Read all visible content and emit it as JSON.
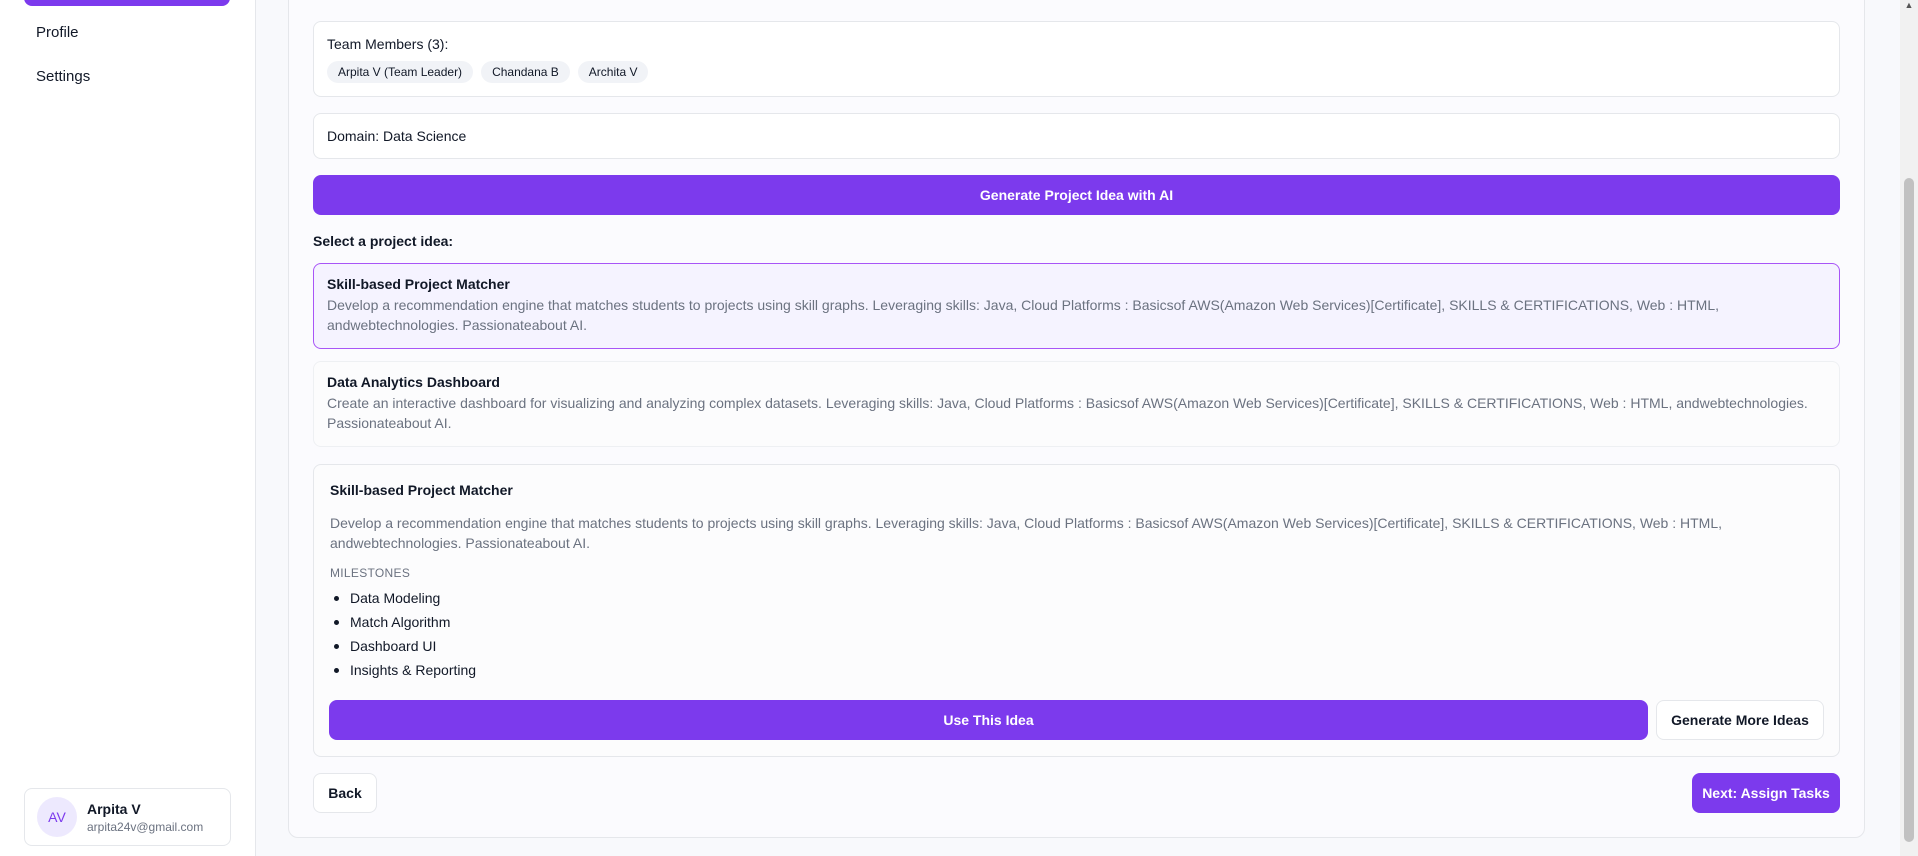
{
  "sidebar": {
    "items": [
      {
        "label": "Profile"
      },
      {
        "label": "Settings"
      }
    ],
    "user": {
      "initials": "AV",
      "name": "Arpita V",
      "email": "arpita24v@gmail.com"
    }
  },
  "team": {
    "heading": "Team Members (3):",
    "members": [
      "Arpita V (Team Leader)",
      "Chandana B",
      "Archita V"
    ]
  },
  "domain": {
    "text": "Domain: Data Science"
  },
  "generate_button": "Generate Project Idea with AI",
  "select_label": "Select a project idea:",
  "ideas": [
    {
      "title": "Skill-based Project Matcher",
      "description": "Develop a recommendation engine that matches students to projects using skill graphs. Leveraging skills: Java, Cloud Platforms : Basicsof AWS(Amazon Web Services)[Certificate], SKILLS & CERTIFICATIONS, Web : HTML, andwebtechnologies. Passionateabout AI."
    },
    {
      "title": "Data Analytics Dashboard",
      "description": "Create an interactive dashboard for visualizing and analyzing complex datasets. Leveraging skills: Java, Cloud Platforms : Basicsof AWS(Amazon Web Services)[Certificate], SKILLS & CERTIFICATIONS, Web : HTML, andwebtechnologies. Passionateabout AI."
    }
  ],
  "detail": {
    "title": "Skill-based Project Matcher",
    "description": "Develop a recommendation engine that matches students to projects using skill graphs. Leveraging skills: Java, Cloud Platforms : Basicsof AWS(Amazon Web Services)[Certificate], SKILLS & CERTIFICATIONS, Web : HTML, andwebtechnologies. Passionateabout AI.",
    "milestones_label": "MILESTONES",
    "milestones": [
      "Data Modeling",
      "Match Algorithm",
      "Dashboard UI",
      "Insights & Reporting"
    ],
    "use_button": "Use This Idea",
    "more_button": "Generate More Ideas"
  },
  "footer": {
    "back_button": "Back",
    "next_button": "Next: Assign Tasks"
  },
  "colors": {
    "accent": "#7c3aed",
    "selected_bg": "#f5f3ff",
    "selected_border": "#a855f7"
  }
}
